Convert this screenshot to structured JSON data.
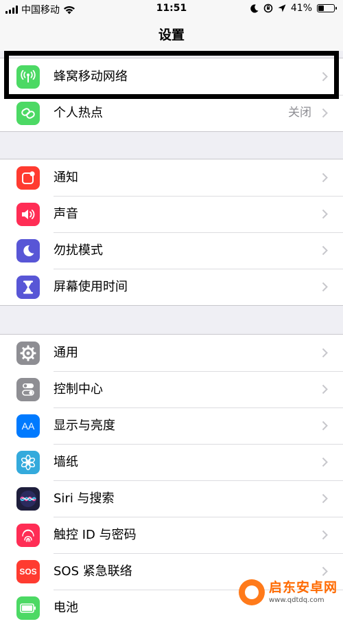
{
  "status_bar": {
    "carrier": "中国移动",
    "time": "11:51",
    "battery_text": "41%",
    "battery_level": 41
  },
  "nav": {
    "title": "设置"
  },
  "group1": [
    {
      "label": "蜂窝移动网络",
      "value": "",
      "icon": "cellular-antenna-icon",
      "color": "#4cd964"
    },
    {
      "label": "个人热点",
      "value": "关闭",
      "icon": "hotspot-link-icon",
      "color": "#4cd964"
    }
  ],
  "group2": [
    {
      "label": "通知",
      "icon": "notifications-icon",
      "color": "#ff3b30"
    },
    {
      "label": "声音",
      "icon": "speaker-icon",
      "color": "#ff2d55"
    },
    {
      "label": "勿扰模式",
      "icon": "moon-icon",
      "color": "#5856d6"
    },
    {
      "label": "屏幕使用时间",
      "icon": "hourglass-icon",
      "color": "#5856d6"
    }
  ],
  "group3": [
    {
      "label": "通用",
      "icon": "gear-icon",
      "color": "#8e8e93"
    },
    {
      "label": "控制中心",
      "icon": "toggles-icon",
      "color": "#8e8e93"
    },
    {
      "label": "显示与亮度",
      "icon_text": "AA",
      "icon": "text-size-icon",
      "color": "#007aff"
    },
    {
      "label": "墙纸",
      "icon": "flower-icon",
      "color": "#34aadc"
    },
    {
      "label": "Siri 与搜索",
      "icon": "siri-icon",
      "color": "#2b2b5e"
    },
    {
      "label": "触控 ID 与密码",
      "icon": "fingerprint-icon",
      "color": "#ff2d55"
    },
    {
      "label": "SOS 紧急联络",
      "icon_text": "SOS",
      "icon": "sos-icon",
      "color": "#ff3b30"
    },
    {
      "label": "电池",
      "icon": "battery-icon",
      "color": "#4cd964"
    }
  ],
  "watermark": {
    "name": "启东安卓网",
    "url": "www.qdtdq.com"
  }
}
